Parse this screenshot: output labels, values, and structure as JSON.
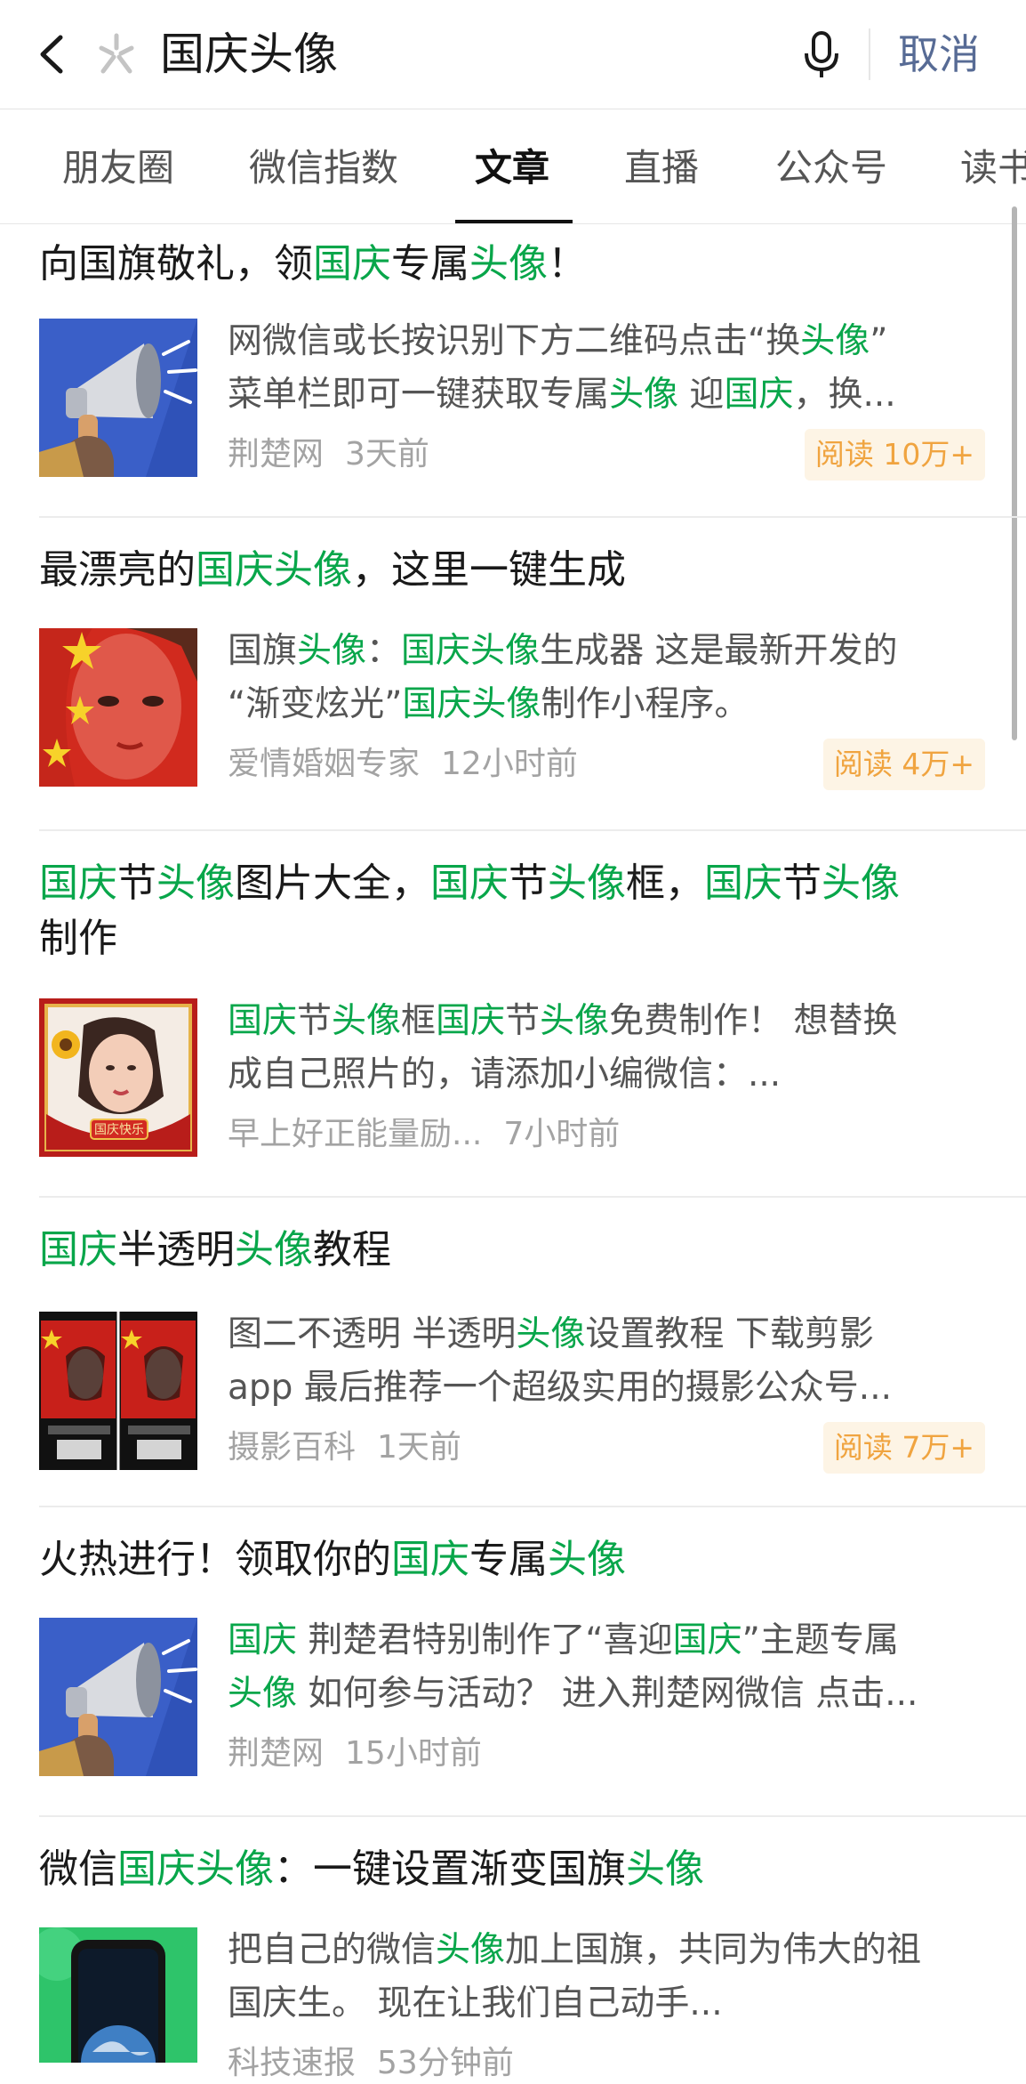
{
  "search": {
    "query": "国庆头像",
    "cancel_label": "取消"
  },
  "tabs": [
    {
      "label": "朋友圈"
    },
    {
      "label": "微信指数"
    },
    {
      "label": "文章"
    },
    {
      "label": "直播"
    },
    {
      "label": "公众号"
    },
    {
      "label": "读书"
    }
  ],
  "articles": [
    {
      "title": [
        [
          "向国旗敬礼，领",
          0
        ],
        [
          "国庆",
          1
        ],
        [
          "专属",
          0
        ],
        [
          "头像",
          1
        ],
        [
          "！",
          0
        ]
      ],
      "snippet": [
        [
          "网微信或长按识别下方二维码点击“换",
          0
        ],
        [
          "头像",
          1
        ],
        [
          "”",
          0
        ],
        [
          "\n",
          0
        ],
        [
          "菜单栏即可一键获取专属",
          0
        ],
        [
          "头像",
          1
        ],
        [
          " 迎",
          0
        ],
        [
          "国庆",
          1
        ],
        [
          "，换...",
          0
        ]
      ],
      "source": "荆楚网",
      "time": "3天前",
      "reads": "阅读 10万+"
    },
    {
      "title": [
        [
          "最漂亮的",
          0
        ],
        [
          "国庆头像",
          1
        ],
        [
          "，这里一键生成",
          0
        ]
      ],
      "snippet": [
        [
          "国旗",
          0
        ],
        [
          "头像",
          1
        ],
        [
          "：",
          0
        ],
        [
          "国庆头像",
          1
        ],
        [
          "生成器 这是最新开发的",
          0
        ],
        [
          "\n",
          0
        ],
        [
          "“渐变炫光”",
          0
        ],
        [
          "国庆头像",
          1
        ],
        [
          "制作小程序。",
          0
        ]
      ],
      "source": "爱情婚姻专家",
      "time": "12小时前",
      "reads": "阅读 4万+"
    },
    {
      "title": [
        [
          "国庆",
          1
        ],
        [
          "节",
          0
        ],
        [
          "头像",
          1
        ],
        [
          "图片大全，",
          0
        ],
        [
          "国庆",
          1
        ],
        [
          "节",
          0
        ],
        [
          "头像",
          1
        ],
        [
          "框，",
          0
        ],
        [
          "国庆",
          1
        ],
        [
          "节",
          0
        ],
        [
          "头像",
          1
        ],
        [
          "\n",
          0
        ],
        [
          "制作",
          0
        ]
      ],
      "snippet": [
        [
          "国庆",
          1
        ],
        [
          "节",
          0
        ],
        [
          "头像",
          1
        ],
        [
          "框",
          0
        ],
        [
          "国庆",
          1
        ],
        [
          "节",
          0
        ],
        [
          "头像",
          1
        ],
        [
          "免费制作！ 想替换",
          0
        ],
        [
          "\n",
          0
        ],
        [
          "成自己照片的，请添加小编微信：...",
          0
        ]
      ],
      "source": "早上好正能量励...",
      "time": "7小时前",
      "reads": ""
    },
    {
      "title": [
        [
          "国庆",
          1
        ],
        [
          "半透明",
          0
        ],
        [
          "头像",
          1
        ],
        [
          "教程",
          0
        ]
      ],
      "snippet": [
        [
          "图二不透明 半透明",
          0
        ],
        [
          "头像",
          1
        ],
        [
          "设置教程 下载剪影",
          0
        ],
        [
          "\n",
          0
        ],
        [
          "app 最后推荐一个超级实用的摄影公众号...",
          0
        ]
      ],
      "source": "摄影百科",
      "time": "1天前",
      "reads": "阅读 7万+"
    },
    {
      "title": [
        [
          "火热进行！领取你的",
          0
        ],
        [
          "国庆",
          1
        ],
        [
          "专属",
          0
        ],
        [
          "头像",
          1
        ]
      ],
      "snippet": [
        [
          "国庆",
          1
        ],
        [
          " 荆楚君特别制作了“喜迎",
          0
        ],
        [
          "国庆",
          1
        ],
        [
          "”主题专属",
          0
        ],
        [
          "\n",
          0
        ],
        [
          "头像",
          1
        ],
        [
          " 如何参与活动？ 进入荆楚网微信 点击...",
          0
        ]
      ],
      "source": "荆楚网",
      "time": "15小时前",
      "reads": ""
    },
    {
      "title": [
        [
          "微信",
          0
        ],
        [
          "国庆头像",
          1
        ],
        [
          "：一键设置渐变国旗",
          0
        ],
        [
          "头像",
          1
        ]
      ],
      "snippet": [
        [
          "把自己的微信",
          0
        ],
        [
          "头像",
          1
        ],
        [
          "加上国旗，共同为伟大的祖",
          0
        ],
        [
          "\n",
          0
        ],
        [
          "国庆生。 现在让我们自己动手...",
          0
        ]
      ],
      "source": "科技速报",
      "time": "53分钟前",
      "reads": ""
    }
  ],
  "thumb_text": {
    "frame_label": "国庆快乐"
  },
  "colors": {
    "highlight": "#08a64a",
    "link": "#576b95",
    "badge_text": "#f0a440",
    "badge_bg": "#fdf4e5"
  },
  "icons": {
    "back": "chevron-left-icon",
    "wechat": "wechat-search-logo-icon",
    "mic": "microphone-icon"
  }
}
